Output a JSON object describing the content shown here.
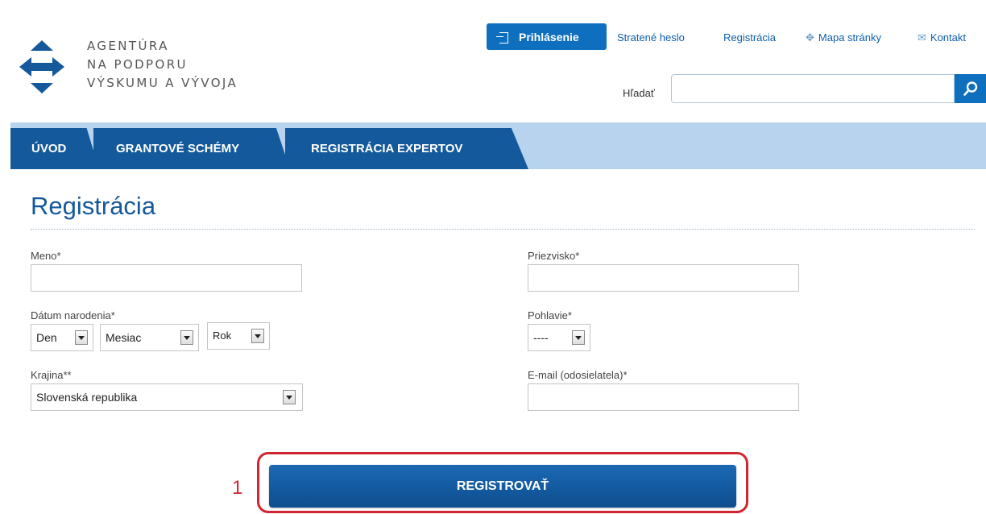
{
  "logo": {
    "line1": "AGENTÚRA",
    "line2": "NA PODPORU",
    "line3": "VÝSKUMU A VÝVOJA"
  },
  "header": {
    "login_label": "Prihlásenie",
    "links": [
      {
        "label": "Stratené heslo",
        "icon": ""
      },
      {
        "label": "Registrácia",
        "icon": ""
      },
      {
        "label": "Mapa stránky",
        "icon": "sitemap-icon"
      },
      {
        "label": "Kontakt",
        "icon": "envelope-icon"
      }
    ],
    "search_label": "Hľadať",
    "search_value": ""
  },
  "nav": {
    "tabs": [
      "ÚVOD",
      "GRANTOVÉ SCHÉMY",
      "REGISTRÁCIA EXPERTOV"
    ]
  },
  "page": {
    "title": "Registrácia"
  },
  "form": {
    "meno_label": "Meno*",
    "priezvisko_label": "Priezvisko*",
    "datum_label": "Dátum narodenia*",
    "day_value": "Den",
    "month_value": "Mesiac",
    "year_value": "Rok",
    "pohlavie_label": "Pohlavie*",
    "pohlavie_value": "----",
    "krajina_label": "Krajina**",
    "krajina_value": "Slovenská republika",
    "email_label": "E-mail (odosielatela)*"
  },
  "register": {
    "label": "REGISTROVAŤ",
    "marker": "1"
  },
  "colors": {
    "primary": "#0d6fbd",
    "nav_dark": "#14599b",
    "nav_light": "#b7d3ee",
    "highlight": "#d0262f"
  }
}
